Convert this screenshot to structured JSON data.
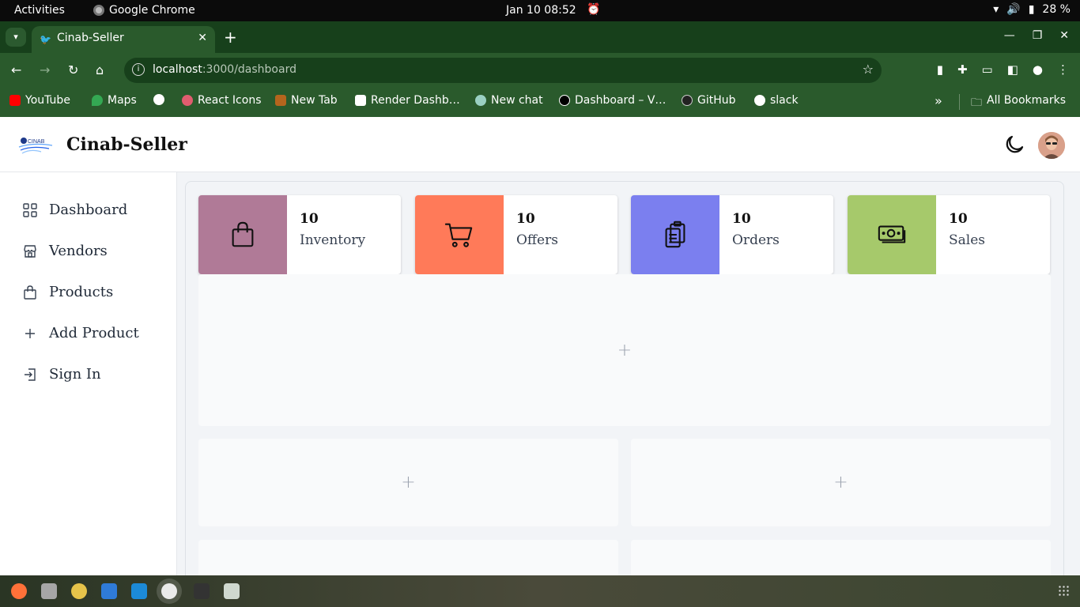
{
  "system": {
    "activities": "Activities",
    "app_name": "Google Chrome",
    "clock": "Jan 10  08:52",
    "battery": "28 %"
  },
  "browser": {
    "tab_title": "Cinab-Seller",
    "url_host": "localhost",
    "url_path": ":3000/dashboard",
    "bookmarks": [
      "YouTube",
      "Maps",
      "React Icons",
      "New Tab",
      "Render Dashb…",
      "New chat",
      "Dashboard – V…",
      "GitHub",
      "slack"
    ],
    "all_bookmarks": "All Bookmarks"
  },
  "header": {
    "title": "Cinab-Seller",
    "logo_text": "CINAB"
  },
  "sidebar": {
    "items": [
      {
        "label": "Dashboard"
      },
      {
        "label": "Vendors"
      },
      {
        "label": "Products"
      },
      {
        "label": "Add Product"
      },
      {
        "label": "Sign In"
      }
    ]
  },
  "stats": [
    {
      "count": "10",
      "label": "Inventory",
      "color": "#b07a97"
    },
    {
      "count": "10",
      "label": "Offers",
      "color": "#ff7a59"
    },
    {
      "count": "10",
      "label": "Orders",
      "color": "#7b7fef"
    },
    {
      "count": "10",
      "label": "Sales",
      "color": "#a6c96b"
    }
  ],
  "placeholders": {
    "symbol": "+"
  }
}
